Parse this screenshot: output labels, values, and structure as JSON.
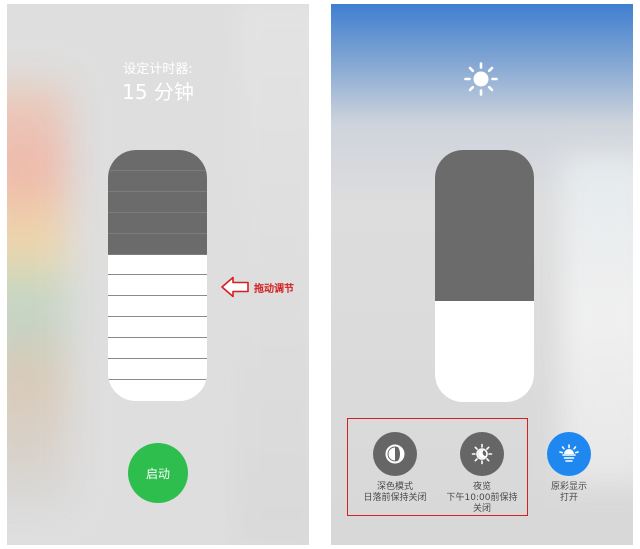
{
  "left_panel": {
    "timer_label": "设定计时器:",
    "timer_value": "15 分钟",
    "slider": {
      "segment_count": 12,
      "filled_segments": 5
    },
    "drag_hint": "拖动调节",
    "start_label": "启动",
    "colors": {
      "start_button": "#2dbe4e",
      "hint": "#d42020",
      "slider_filled": "#6b6b6b"
    }
  },
  "right_panel": {
    "brightness_icon": "sun-icon",
    "brightness_level": 0.4,
    "controls": {
      "dark_mode": {
        "line1": "深色模式",
        "line2": "日落前保持关闭",
        "icon": "dark-mode-icon"
      },
      "night_shift": {
        "line1": "夜览",
        "line2": "下午10:00前保持",
        "line3": "关闭",
        "icon": "night-shift-icon"
      },
      "true_tone": {
        "line1": "原彩显示",
        "line2": "打开",
        "icon": "true-tone-icon"
      }
    },
    "colors": {
      "true_tone_active": "#1e88f0",
      "inactive_button": "#666666",
      "annotation_box": "#d42020"
    }
  }
}
